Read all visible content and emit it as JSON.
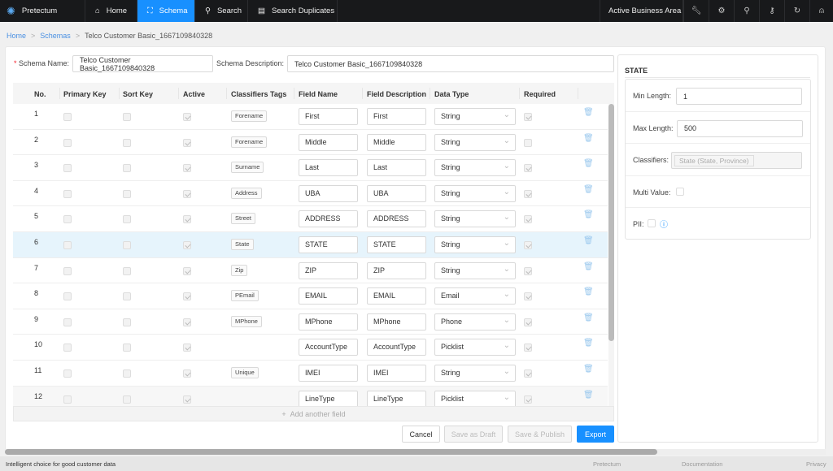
{
  "nav": {
    "brand": "Pretectum",
    "items": [
      {
        "label": "Home",
        "icon": "home-icon"
      },
      {
        "label": "Schema",
        "icon": "sitemap-icon",
        "active": true
      },
      {
        "label": "Search",
        "icon": "search-icon"
      },
      {
        "label": "Search Duplicates",
        "icon": "file-search-icon"
      }
    ],
    "business_area": "Active Business Area",
    "right_icons": [
      "wrench-icon",
      "gear-icon",
      "zoom-icon",
      "key-icon",
      "logout-icon",
      "user-icon"
    ]
  },
  "breadcrumb": [
    "Home",
    "Schemas",
    "Telco Customer Basic_1667109840328"
  ],
  "form": {
    "schema_name_label": "Schema Name",
    "schema_name": "Telco Customer Basic_1667109840328",
    "schema_desc_label": "Schema Description",
    "schema_desc": "Telco Customer Basic_1667109840328"
  },
  "table": {
    "headers": [
      "No.",
      "Primary Key",
      "Sort Key",
      "Active",
      "Classifiers Tags",
      "Field Name",
      "Field Description",
      "Data Type",
      "Required"
    ],
    "rows": [
      {
        "no": "1",
        "tag": "Forename",
        "name": "First",
        "desc": "First",
        "type": "String",
        "required": true
      },
      {
        "no": "2",
        "tag": "Forename",
        "name": "Middle",
        "desc": "Middle",
        "type": "String",
        "required": false
      },
      {
        "no": "3",
        "tag": "Surname",
        "name": "Last",
        "desc": "Last",
        "type": "String",
        "required": true
      },
      {
        "no": "4",
        "tag": "Address",
        "name": "UBA",
        "desc": "UBA",
        "type": "String",
        "required": true
      },
      {
        "no": "5",
        "tag": "Street",
        "name": "ADDRESS",
        "desc": "ADDRESS",
        "type": "String",
        "required": true
      },
      {
        "no": "6",
        "tag": "State",
        "name": "STATE",
        "desc": "STATE",
        "type": "String",
        "required": true,
        "selected": true
      },
      {
        "no": "7",
        "tag": "Zip",
        "name": "ZIP",
        "desc": "ZIP",
        "type": "String",
        "required": true
      },
      {
        "no": "8",
        "tag": "PEmail",
        "name": "EMAIL",
        "desc": "EMAIL",
        "type": "Email",
        "required": true
      },
      {
        "no": "9",
        "tag": "MPhone",
        "name": "MPhone",
        "desc": "MPhone",
        "type": "Phone",
        "required": true
      },
      {
        "no": "10",
        "tag": "",
        "name": "AccountType",
        "desc": "AccountType",
        "type": "Picklist",
        "required": true
      },
      {
        "no": "11",
        "tag": "Unique",
        "name": "IMEI",
        "desc": "IMEI",
        "type": "String",
        "required": true
      },
      {
        "no": "12",
        "tag": "",
        "name": "LineType",
        "desc": "LineType",
        "type": "Picklist",
        "required": true
      }
    ],
    "add_label": "Add another field"
  },
  "actions": {
    "cancel": "Cancel",
    "save_draft": "Save as Draft",
    "save_publish": "Save & Publish",
    "export": "Export"
  },
  "panel": {
    "title": "STATE",
    "min_length_label": "Min Length",
    "min_length": "1",
    "max_length_label": "Max Length",
    "max_length": "500",
    "classifiers_label": "Classifiers",
    "classifier": "State (State, Province)",
    "multi_value_label": "Multi Value",
    "pii_label": "PII"
  },
  "footer": {
    "tagline": "Intelligent choice for good customer data",
    "links": [
      "Pretectum",
      "Documentation",
      "Privacy"
    ]
  },
  "colors": {
    "accent": "#1890ff",
    "nav_bg": "#18191b",
    "selected_row": "#e6f4fc"
  }
}
